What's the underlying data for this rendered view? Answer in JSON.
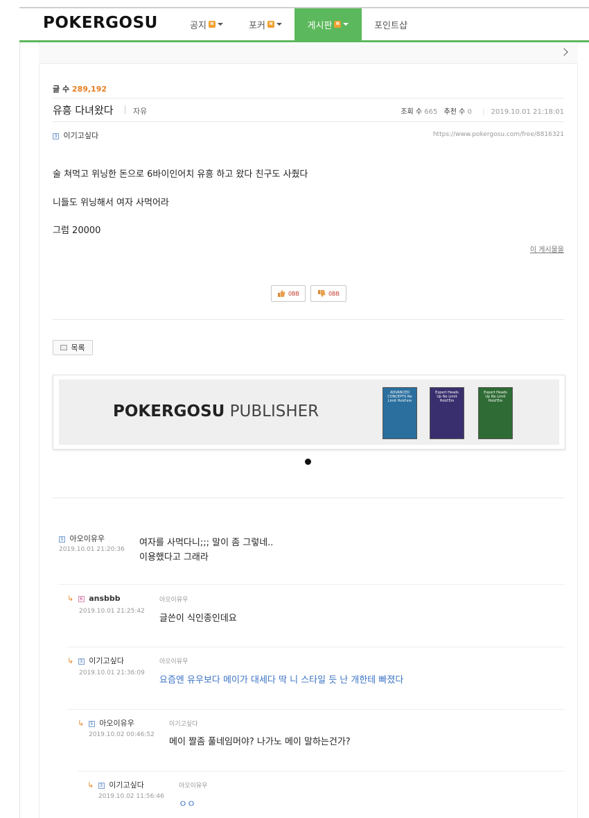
{
  "nav": {
    "logo": "POKERGOSU",
    "menus": [
      {
        "label": "공지",
        "badge": "N",
        "active": false,
        "dropdown": true
      },
      {
        "label": "포커",
        "badge": "N",
        "active": false,
        "dropdown": true
      },
      {
        "label": "게시판",
        "badge": "N",
        "active": true,
        "dropdown": true
      },
      {
        "label": "포인트샵",
        "badge": "",
        "active": false,
        "dropdown": false
      }
    ]
  },
  "board": {
    "count_label": "글 수",
    "count_value": "289,192"
  },
  "post": {
    "title": "유흥 다녀왔다",
    "category": "자유",
    "views_label": "조회 수",
    "views": "665",
    "recommend_label": "추천 수",
    "recommend": "0",
    "datetime": "2019.10.01 21:18:01",
    "author_level": "3",
    "author": "이기고싶다",
    "url": "https://www.pokergosu.com/free/8816321",
    "body": [
      "술 쳐먹고 위닝한 돈으로 6바이인어치 유흥 하고 왔다 친구도 사줬다",
      "니들도 위닝해서 여자 사먹어라",
      "그럼 20000"
    ],
    "author_posts_link": "이 게시물을",
    "vote_up": "0BB",
    "vote_down": "0BB",
    "list_button": "목록"
  },
  "banner": {
    "brand_bold": "POKERGOSU",
    "brand_light": "PUBLISHER",
    "books": [
      {
        "title": "ADVANCED CONCEPTS No Limit Hold'em",
        "color": "#2a6f9e"
      },
      {
        "title": "Expert Heads Up No Limit Hold'Em",
        "color": "#3a2f6e"
      },
      {
        "title": "Expert Heads Up No Limit Hold'Em",
        "color": "#2f6b34"
      }
    ]
  },
  "comments": [
    {
      "level": "5",
      "author": "아오이유우",
      "date": "2019.10.01 21:20:36",
      "reply_to": "",
      "lines": [
        "여자를 사먹다니;;; 말이 좀 그렇네..",
        "이용했다고 그래라"
      ],
      "blue": false
    },
    {
      "level": "6",
      "author": "ansbbb",
      "date": "2019.10.01 21:25:42",
      "reply_to": "아오이유우",
      "lines": [
        "글쓴이 식인종인데요"
      ],
      "blue": false
    },
    {
      "level": "3",
      "author": "이기고싶다",
      "date": "2019.10.01 21:36:09",
      "reply_to": "아오이유우",
      "lines": [
        "요즘엔 유우보다 메이가 대세다 딱 니 스타일 듯 난 개한테 빠졌다"
      ],
      "blue": true
    },
    {
      "level": "5",
      "author": "아오이유우",
      "date": "2019.10.02 00:46:52",
      "reply_to": "이기고싶다",
      "lines": [
        "메이 짤좀 풀네임머야? 나가노 메이 말하는건가?"
      ],
      "blue": false
    },
    {
      "level": "3",
      "author": "이기고싶다",
      "date": "2019.10.02 11:56:46",
      "reply_to": "아오이유우",
      "lines": [
        "ㅇㅇ"
      ],
      "blue": true
    }
  ]
}
